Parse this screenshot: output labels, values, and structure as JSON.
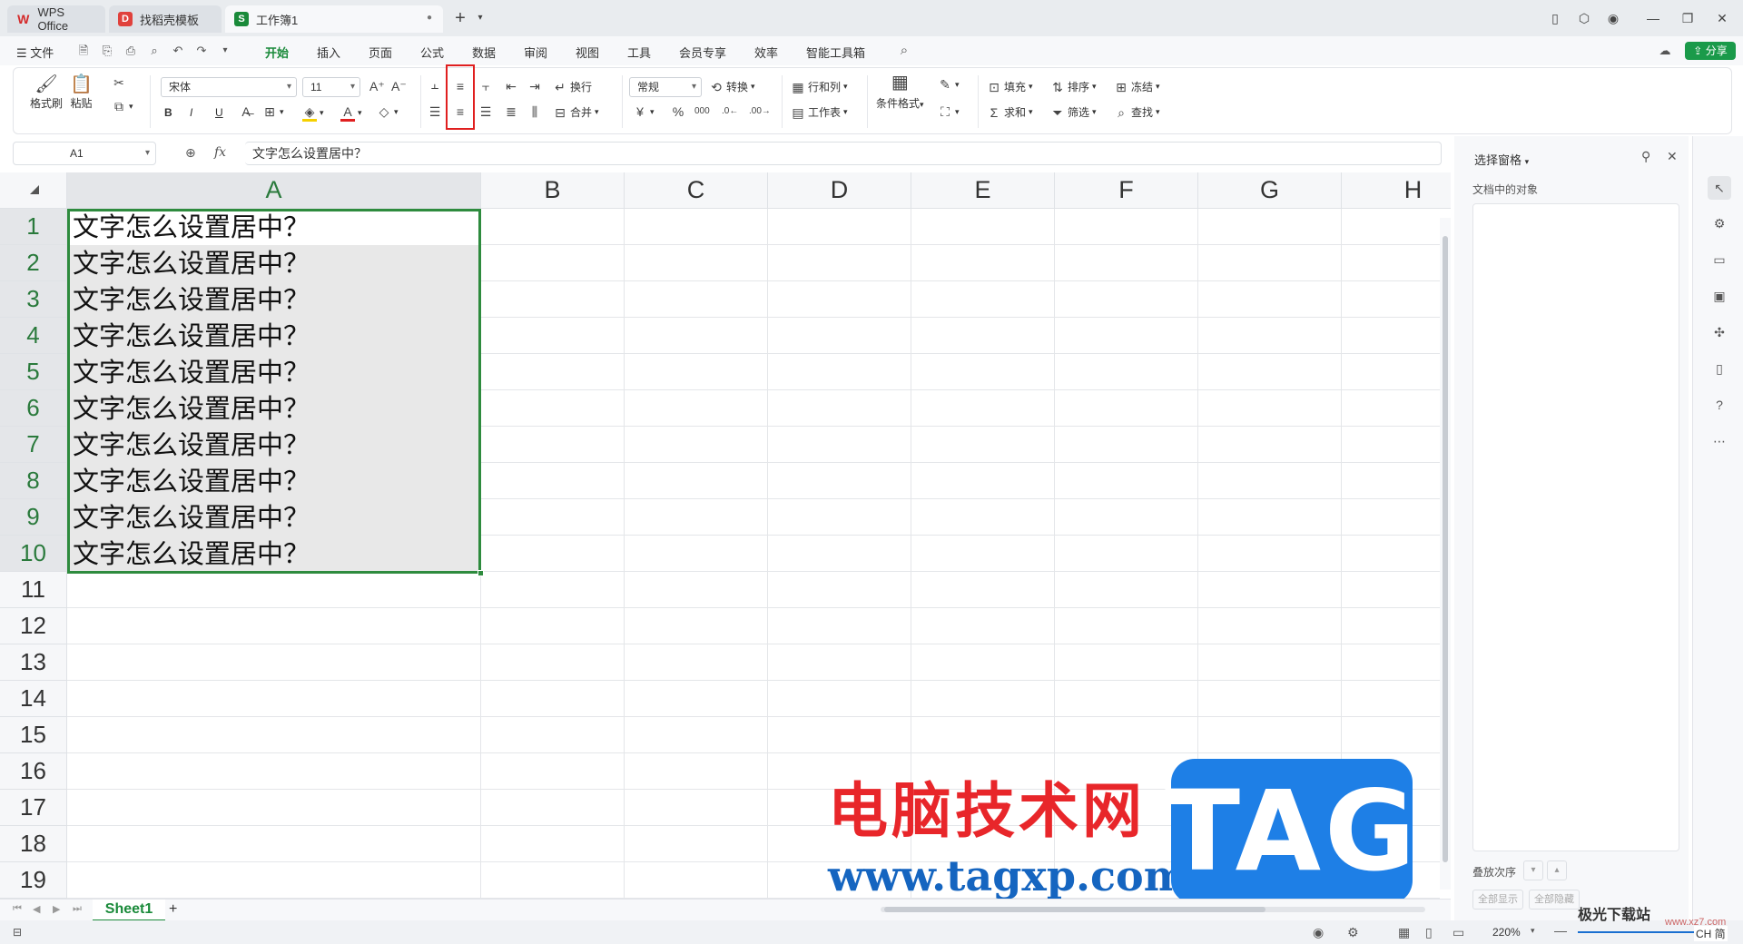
{
  "tabs": [
    {
      "label": "WPS Office",
      "logo": "W"
    },
    {
      "label": "找稻壳模板",
      "logo": "D"
    },
    {
      "label": "工作簿1",
      "logo": "S"
    }
  ],
  "menu": {
    "file": "文件",
    "items": [
      "开始",
      "插入",
      "页面",
      "公式",
      "数据",
      "审阅",
      "视图",
      "工具",
      "会员专享",
      "效率",
      "智能工具箱"
    ],
    "active": "开始",
    "share": "分享"
  },
  "ribbon": {
    "format_painter": "格式刷",
    "paste": "粘贴",
    "font_name": "宋体",
    "font_size": "11",
    "bold": "B",
    "italic": "I",
    "underline": "U",
    "wrap": "换行",
    "merge": "合并",
    "number_format": "常规",
    "convert": "转换",
    "rows_cols": "行和列",
    "worksheet": "工作表",
    "cond_format": "条件格式",
    "fill": "填充",
    "sort": "排序",
    "freeze": "冻结",
    "sum": "求和",
    "filter": "筛选",
    "find": "查找"
  },
  "formula_bar": {
    "cell_ref": "A1",
    "fx": "fx",
    "content": "文字怎么设置居中？"
  },
  "grid": {
    "columns": [
      "A",
      "B",
      "C",
      "D",
      "E",
      "F",
      "G",
      "H"
    ],
    "rows": [
      "1",
      "2",
      "3",
      "4",
      "5",
      "6",
      "7",
      "8",
      "9",
      "10",
      "11",
      "12",
      "13",
      "14",
      "15",
      "16",
      "17",
      "18",
      "19"
    ],
    "cells_a": [
      "文字怎么设置居中？",
      "文字怎么设置居中？",
      "文字怎么设置居中？",
      "文字怎么设置居中？",
      "文字怎么设置居中？",
      "文字怎么设置居中？",
      "文字怎么设置居中？",
      "文字怎么设置居中？",
      "文字怎么设置居中？",
      "文字怎么设置居中？"
    ]
  },
  "panel": {
    "title": "选择窗格",
    "subtitle": "文档中的对象",
    "order_label": "叠放次序",
    "show_all": "全部显示",
    "hide_all": "全部隐藏"
  },
  "sheet": {
    "name": "Sheet1",
    "add": "+"
  },
  "status": {
    "zoom": "220%",
    "lang": "CH 简"
  },
  "watermark": {
    "cn": "电脑技术网",
    "url": "www.tagxp.com",
    "tag": "TAG",
    "corner": "极光下载站",
    "corner_url": "www.xz7.com"
  },
  "colors": {
    "accent": "#1a8a3a",
    "selection_border": "#2e8b3e",
    "highlight_box": "#e01f1f"
  }
}
